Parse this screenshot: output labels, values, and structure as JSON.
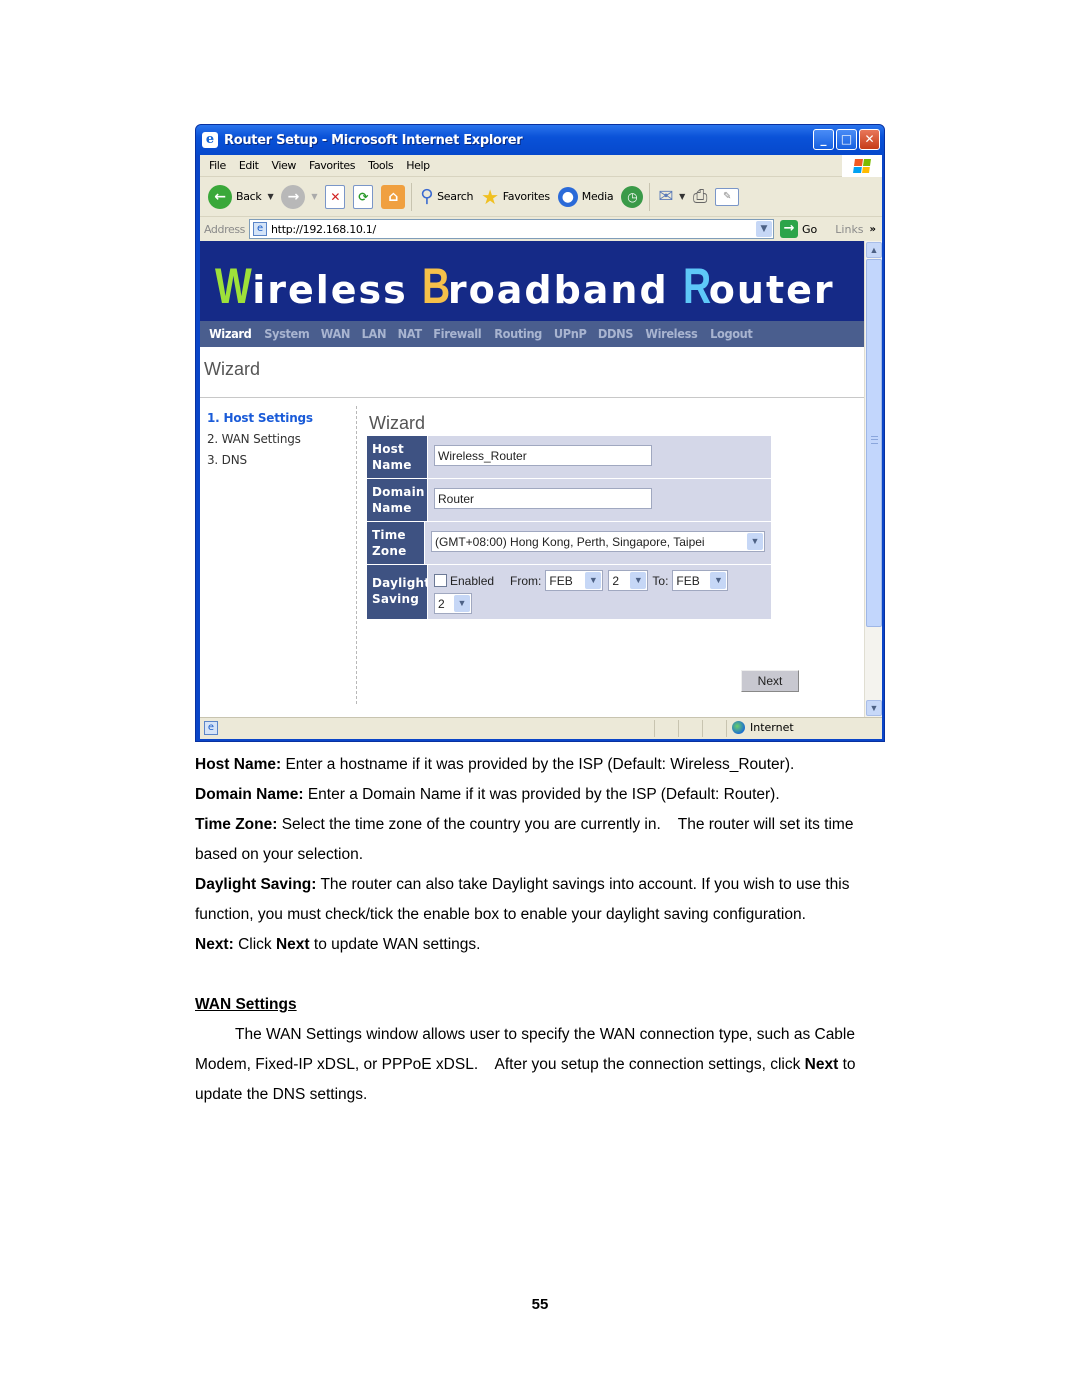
{
  "browser": {
    "title": "Router Setup - Microsoft Internet Explorer",
    "menu": [
      "File",
      "Edit",
      "View",
      "Favorites",
      "Tools",
      "Help"
    ],
    "toolbar": {
      "back": "Back",
      "search": "Search",
      "favorites": "Favorites",
      "media": "Media"
    },
    "address_label": "Address",
    "url": "http://192.168.10.1/",
    "go_label": "Go",
    "links_label": "Links",
    "status_zone": "Internet"
  },
  "router": {
    "brand": {
      "w_initial": "W",
      "w_rest": "ireless",
      "b_initial": "B",
      "b_rest": "roadband",
      "r_initial": "R",
      "r_rest": "outer",
      "colors": {
        "w": "#9ee03a",
        "b": "#f5c04a",
        "r": "#5ec8f8"
      }
    },
    "nav": [
      "Wizard",
      "System",
      "WAN",
      "LAN",
      "NAT",
      "Firewall",
      "Routing",
      "UPnP",
      "DDNS",
      "Wireless",
      "Logout"
    ],
    "active_nav": "Wizard",
    "page_title": "Wizard",
    "steps": [
      "1. Host Settings",
      "2. WAN Settings",
      "3. DNS"
    ],
    "active_step": 0,
    "form_title": "Wizard",
    "form": {
      "host_name_label_1": "Host",
      "host_name_label_2": "Name",
      "host_name_value": "Wireless_Router",
      "domain_name_label_1": "Domain",
      "domain_name_label_2": "Name",
      "domain_name_value": "Router",
      "time_zone_label_1": "Time",
      "time_zone_label_2": "Zone",
      "time_zone_value": "(GMT+08:00) Hong Kong, Perth, Singapore, Taipei",
      "daylight_label_1": "Daylight",
      "daylight_label_2": "Saving",
      "enabled_label": "Enabled",
      "enabled_checked": false,
      "from_label": "From:",
      "from_month": "FEB",
      "from_day": "2",
      "to_label": "To:",
      "to_month": "FEB",
      "to_day": "2"
    },
    "next_label": "Next"
  },
  "doc": {
    "host_name_term": "Host Name:",
    "host_name_desc": " Enter a hostname if it was provided by the ISP (Default: Wireless_Router).",
    "domain_name_term": "Domain Name:",
    "domain_name_desc": " Enter a Domain Name if it was provided by the ISP (Default: Router).",
    "time_zone_term": "Time Zone:",
    "time_zone_desc": " Select the time zone of the country you are currently in.    The router will set its time based on your selection.",
    "daylight_term": "Daylight Saving:",
    "daylight_desc": " The router can also take Daylight savings into account. If you wish to use this function, you must check/tick the enable box to enable your daylight saving configuration.",
    "next_term": "Next:",
    "next_desc_1": " Click ",
    "next_desc_bold": "Next",
    "next_desc_2": " to update WAN settings.",
    "wan_heading": "WAN Settings",
    "wan_para_1": "The WAN Settings window allows user to specify the WAN connection type, such as Cable Modem, Fixed-IP xDSL, or PPPoE xDSL.    After you setup the connection settings, click ",
    "wan_para_bold": "Next",
    "wan_para_2": " to update the DNS settings.",
    "page_number": "55"
  }
}
